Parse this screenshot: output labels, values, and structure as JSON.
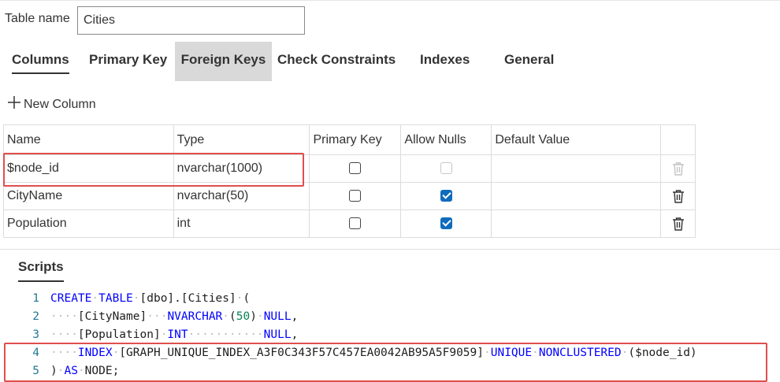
{
  "table_name": {
    "label": "Table name",
    "value": "Cities"
  },
  "tabs": [
    {
      "label": "Columns"
    },
    {
      "label": "Primary Key"
    },
    {
      "label": "Foreign Keys"
    },
    {
      "label": "Check Constraints"
    },
    {
      "label": "Indexes"
    },
    {
      "label": "General"
    }
  ],
  "toolbar": {
    "new_column_label": "New Column"
  },
  "columns_grid": {
    "headers": [
      "Name",
      "Type",
      "Primary Key",
      "Allow Nulls",
      "Default Value",
      ""
    ],
    "rows": [
      {
        "name": "$node_id",
        "type": "nvarchar(1000)",
        "primary_key": false,
        "allow_nulls": false,
        "allow_nulls_disabled": true,
        "default_value": "",
        "delete_disabled": true
      },
      {
        "name": "CityName",
        "type": "nvarchar(50)",
        "primary_key": false,
        "allow_nulls": true,
        "allow_nulls_disabled": false,
        "default_value": "",
        "delete_disabled": false
      },
      {
        "name": "Population",
        "type": "int",
        "primary_key": false,
        "allow_nulls": true,
        "allow_nulls_disabled": false,
        "default_value": "",
        "delete_disabled": false
      }
    ]
  },
  "scripts": {
    "title": "Scripts",
    "line_numbers": [
      "1",
      "2",
      "3",
      "4",
      "5"
    ],
    "lines": [
      "CREATE TABLE [dbo].[Cities] (",
      "    [CityName]   NVARCHAR (50) NULL,",
      "    [Population] INT           NULL,",
      "    INDEX [GRAPH_UNIQUE_INDEX_A3F0C343F57C457EA0042AB95A5F9059] UNIQUE NONCLUSTERED ($node_id)",
      ") AS NODE;"
    ]
  },
  "colors": {
    "accent": "#0f6cbd",
    "highlight_box": "#e04e4e",
    "keyword": "#0000ff",
    "line_number": "#237893"
  }
}
